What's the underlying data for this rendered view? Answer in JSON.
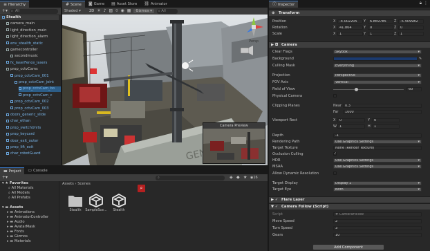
{
  "hierarchy": {
    "tab": "Hierarchy",
    "search_placeholder": "All",
    "items": [
      {
        "label": "Stealth",
        "indent": 0,
        "bold": true,
        "kind": "scene"
      },
      {
        "label": "camera_main",
        "indent": 1,
        "kind": "obj"
      },
      {
        "label": "light_direction_main",
        "indent": 1,
        "kind": "obj"
      },
      {
        "label": "light_direction_alarm",
        "indent": 1,
        "kind": "obj"
      },
      {
        "label": "env_stealth_static",
        "indent": 1,
        "kind": "prefab"
      },
      {
        "label": "gamecontroller",
        "indent": 1,
        "kind": "obj"
      },
      {
        "label": "secondmusic",
        "indent": 2,
        "kind": "obj"
      },
      {
        "label": "fx_laserFence_lasers",
        "indent": 1,
        "kind": "prefab"
      },
      {
        "label": "prop_cctvCams",
        "indent": 1,
        "kind": "obj"
      },
      {
        "label": "prop_cctvCam_001",
        "indent": 2,
        "kind": "prefab"
      },
      {
        "label": "prop_cctvCam_joint",
        "indent": 3,
        "kind": "prefab"
      },
      {
        "label": "prop_cctvCam_bo",
        "indent": 4,
        "kind": "prefab"
      },
      {
        "label": "prop_cctvCam_c",
        "indent": 4,
        "kind": "prefab"
      },
      {
        "label": "prop_cctvCam_002",
        "indent": 2,
        "kind": "prefab"
      },
      {
        "label": "prop_cctvCam_003",
        "indent": 2,
        "kind": "prefab"
      },
      {
        "label": "doors_generic_slide",
        "indent": 1,
        "kind": "prefab"
      },
      {
        "label": "char_ethan",
        "indent": 1,
        "kind": "prefab"
      },
      {
        "label": "prop_switchUnits",
        "indent": 1,
        "kind": "prefab"
      },
      {
        "label": "prop_keycard",
        "indent": 1,
        "kind": "prefab"
      },
      {
        "label": "door_exit_outer",
        "indent": 1,
        "kind": "prefab"
      },
      {
        "label": "prop_lift_exit",
        "indent": 1,
        "kind": "prefab"
      },
      {
        "label": "char_robotGuard",
        "indent": 1,
        "kind": "prefab"
      }
    ]
  },
  "scene": {
    "tabs": [
      "Scene",
      "Game",
      "Asset Store",
      "Animator"
    ],
    "shading": "Shaded",
    "mode_2d": "2D",
    "gizmos": "Gizmos",
    "gizmo_search": "All",
    "persp_label": "Persp",
    "camera_preview_title": "Camera Preview"
  },
  "project": {
    "tabs": [
      "Project",
      "Console"
    ],
    "favorites_label": "Favorites",
    "favorites": [
      "All Materials",
      "All Models",
      "All Prefabs"
    ],
    "assets_label": "Assets",
    "folders": [
      "Animations",
      "AnimatorController",
      "Audio",
      "AvatarMask",
      "Fonts",
      "Gizmos",
      "Materials"
    ],
    "breadcrumb": [
      "Assets",
      "Scenes"
    ],
    "count": "16",
    "assets": [
      {
        "name": "Stealth",
        "kind": "folder"
      },
      {
        "name": "SampleSce...",
        "kind": "unity"
      },
      {
        "name": "Stealth",
        "kind": "unity"
      }
    ]
  },
  "inspector": {
    "tab": "Inspector",
    "transform": {
      "title": "Transform",
      "rows": [
        {
          "label": "Position",
          "x": "-4.002205",
          "y": "6.869785",
          "z": "-5.409982"
        },
        {
          "label": "Rotation",
          "x": "41.804",
          "y": "0",
          "z": "0"
        },
        {
          "label": "Scale",
          "x": "1",
          "y": "1",
          "z": "1"
        }
      ]
    },
    "camera": {
      "title": "Camera",
      "clear_flags": {
        "label": "Clear Flags",
        "value": "Skybox"
      },
      "background_label": "Background",
      "background_color": "#1b3a6e",
      "culling_mask": {
        "label": "Culling Mask",
        "value": "Everything"
      },
      "projection": {
        "label": "Projection",
        "value": "Perspective"
      },
      "fov_axis": {
        "label": "FOV Axis",
        "value": "Vertical"
      },
      "fov": {
        "label": "Field of View",
        "value": "60",
        "fraction": 0.33
      },
      "physical_camera": "Physical Camera",
      "clipping_planes": "Clipping Planes",
      "near": {
        "label": "Near",
        "value": "0.3"
      },
      "far": {
        "label": "Far",
        "value": "1000"
      },
      "viewport_rect": "Viewport Rect",
      "vp": {
        "x": "0",
        "y": "0",
        "w": "1",
        "h": "1"
      },
      "depth": {
        "label": "Depth",
        "value": "-1"
      },
      "rendering_path": {
        "label": "Rendering Path",
        "value": "Use Graphics Settings"
      },
      "target_texture": {
        "label": "Target Texture",
        "value": "None (Render Texture)"
      },
      "occlusion_culling": "Occlusion Culling",
      "hdr": {
        "label": "HDR",
        "value": "Use Graphics Settings"
      },
      "msaa": {
        "label": "MSAA",
        "value": "Use Graphics Settings"
      },
      "dynamic_resolution": "Allow Dynamic Resolution",
      "target_display": {
        "label": "Target Display",
        "value": "Display 1"
      },
      "target_eye": {
        "label": "Target Eye",
        "value": "Both"
      }
    },
    "flare_layer": "Flare Layer",
    "camera_follow": {
      "title": "Camera Follow (Script)",
      "script": {
        "label": "Script",
        "value": "CameraFollow"
      },
      "move_speed": {
        "label": "Move Speed",
        "value": "2"
      },
      "turn_speed": {
        "label": "Turn Speed",
        "value": "3"
      },
      "gears": {
        "label": "Gears",
        "value": "10"
      }
    },
    "add_component": "Add Component"
  }
}
